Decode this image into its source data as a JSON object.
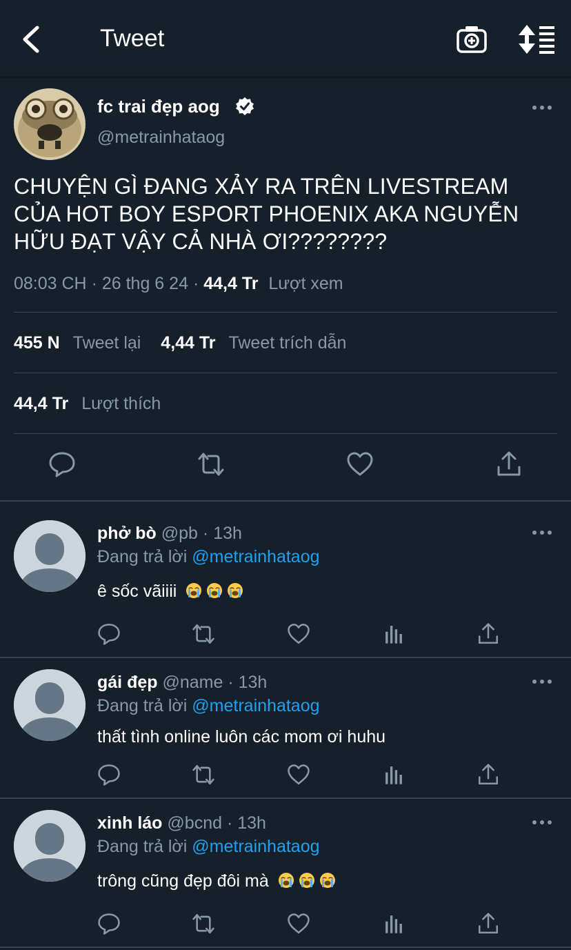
{
  "header": {
    "title": "Tweet",
    "icons": {
      "back": "back-arrow-icon",
      "camera": "camera-plus-icon",
      "sort": "sort-lines-icon"
    }
  },
  "main_tweet": {
    "author_name": "fc trai đẹp aog",
    "author_handle": "@metrainhataog",
    "text": "CHUYỆN GÌ ĐANG XẢY RA TRÊN LIVESTREAM CỦA HOT BOY ESPORT PHOENIX AKA NGUYỄN HỮU ĐẠT VẬY CẢ NHÀ ƠI????????",
    "time": "08:03 CH",
    "date": "26 thg 6 24",
    "views_count": "44,4 Tr",
    "views_label": "Lượt xem",
    "retweets_count": "455 N",
    "retweets_label": "Tweet lại",
    "quotes_count": "4,44 Tr",
    "quotes_label": "Tweet trích dẫn",
    "likes_count": "44,4 Tr",
    "likes_label": "Lượt thích"
  },
  "replies": [
    {
      "name": "phở bò",
      "handle": "@pb",
      "time": "13h",
      "replying_prefix": "Đang trả lời",
      "replying_to": "@metrainhataog",
      "text": "ê sốc vãiiii",
      "emoji_count": 3,
      "emoji": "loudly-crying-face"
    },
    {
      "name": "gái đẹp",
      "handle": "@name",
      "time": "13h",
      "replying_prefix": "Đang trả lời",
      "replying_to": "@metrainhataog",
      "text": "thất tình online luôn các mom ơi huhu",
      "emoji_count": 0
    },
    {
      "name": "xinh láo",
      "handle": "@bcnd",
      "time": "13h",
      "replying_prefix": "Đang trả lời",
      "replying_to": "@metrainhataog",
      "text": "trông cũng đẹp đôi mà",
      "emoji_count": 3,
      "emoji": "loudly-crying-face"
    }
  ],
  "separator": "·",
  "colors": {
    "background": "#15202b",
    "text_secondary": "#8899a6",
    "accent": "#1da1f2",
    "divider": "#38444d",
    "avatar_placeholder_bg": "#ccd6dd",
    "avatar_placeholder_fg": "#657786"
  }
}
